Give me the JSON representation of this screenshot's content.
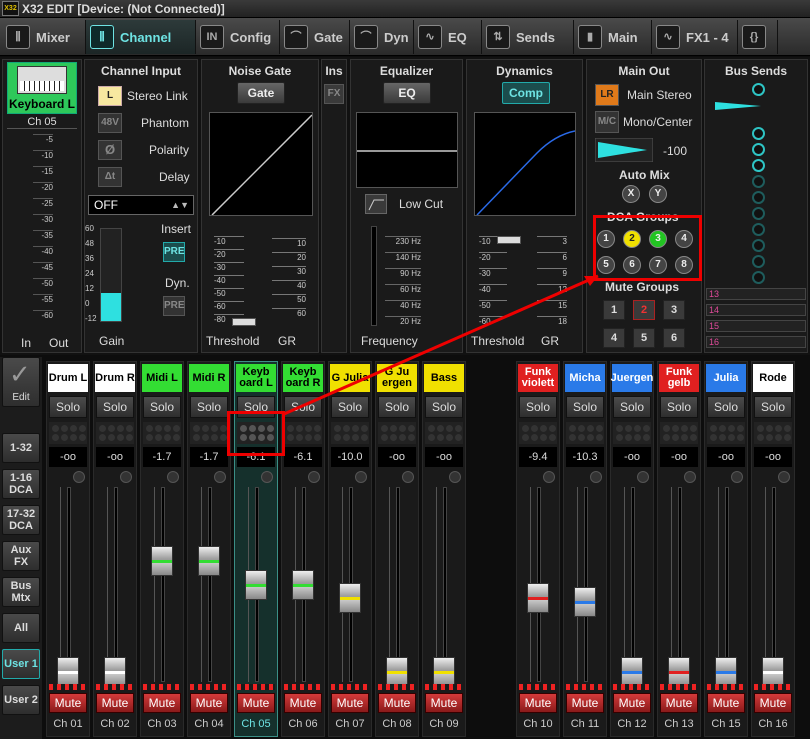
{
  "title": "X32 EDIT [Device: (Not Connected)]",
  "logo": "X32 EDIT",
  "tabs": [
    {
      "label": "Mixer",
      "icon": "faders-icon"
    },
    {
      "label": "Channel",
      "icon": "channel-faders-icon"
    },
    {
      "label": "Config",
      "icon": "input-icon"
    },
    {
      "label": "Gate",
      "icon": "gate-curve-icon"
    },
    {
      "label": "Dyn",
      "icon": "dynamics-curve-icon"
    },
    {
      "label": "EQ",
      "icon": "eq-curve-icon"
    },
    {
      "label": "Sends",
      "icon": "sends-icon"
    },
    {
      "label": "Main",
      "icon": "main-icon"
    },
    {
      "label": "FX1 - 4",
      "icon": "fx-wave-icon"
    },
    {
      "label": "{FX}",
      "icon": "fx-bracket-icon"
    }
  ],
  "channel_badge": {
    "name": "Keyboard L",
    "number": "Ch 05",
    "in_label": "In",
    "out_label": "Out",
    "scale": [
      "-5",
      "-10",
      "-15",
      "-20",
      "-25",
      "-30",
      "-35",
      "-40",
      "-45",
      "-50",
      "-55",
      "-60"
    ]
  },
  "channel_input": {
    "title": "Channel Input",
    "link_btn": "L",
    "stereo_link": "Stereo Link",
    "phantom_btn": "48V",
    "phantom": "Phantom",
    "polarity_btn": "Ø",
    "polarity": "Polarity",
    "delay_btn": "Δt",
    "delay": "Delay",
    "select_value": "OFF",
    "insert": "Insert",
    "dyn": "Dyn.",
    "pre": "PRE",
    "gain_label": "Gain",
    "gain_scale": [
      "60",
      "48",
      "36",
      "24",
      "12",
      "0",
      "-12"
    ],
    "gain_fraction": 0.3
  },
  "noise_gate": {
    "title": "Noise Gate",
    "btn": "Gate",
    "threshold": "Threshold",
    "gr": "GR",
    "scale_left": [
      "-10",
      "-20",
      "-30",
      "-40",
      "-50",
      "-60",
      "-80"
    ],
    "scale_right": [
      "10",
      "20",
      "30",
      "40",
      "50",
      "60"
    ]
  },
  "ins": {
    "title": "Ins",
    "fx": "FX"
  },
  "equalizer": {
    "title": "Equalizer",
    "btn": "EQ",
    "low_cut": "Low Cut",
    "frequency": "Frequency",
    "freq_scale": [
      "230 Hz",
      "140 Hz",
      "90 Hz",
      "60 Hz",
      "40 Hz",
      "20 Hz"
    ]
  },
  "dynamics": {
    "title": "Dynamics",
    "btn": "Comp",
    "threshold": "Threshold",
    "gr": "GR",
    "scale_left": [
      "-10",
      "-20",
      "-30",
      "-40",
      "-50",
      "-60"
    ],
    "scale_right": [
      "3",
      "6",
      "9",
      "12",
      "15",
      "18"
    ]
  },
  "main_out": {
    "title": "Main Out",
    "lr_btn": "LR",
    "main_stereo": "Main Stereo",
    "mc_btn": "M/C",
    "mono_center": "Mono/Center",
    "level": "-100",
    "auto_mix": "Auto Mix",
    "x": "X",
    "y": "Y",
    "dca_title": "DCA Groups",
    "dca": [
      "1",
      "2",
      "3",
      "4",
      "5",
      "6",
      "7",
      "8"
    ],
    "mute_title": "Mute Groups",
    "mute": [
      "1",
      "2",
      "3",
      "4",
      "5",
      "6"
    ]
  },
  "bus_sends": {
    "title": "Bus Sends",
    "bars": [
      "13",
      "14",
      "15",
      "16"
    ]
  },
  "colors": {
    "accent": "#2ec4c4",
    "yellow": "#f0e000",
    "green": "#22c422",
    "red": "#e02020"
  },
  "side_buttons": [
    {
      "label": "Edit"
    },
    {
      "label": "1-32"
    },
    {
      "label": "1-16 DCA"
    },
    {
      "label": "17-32 DCA"
    },
    {
      "label": "Aux FX"
    },
    {
      "label": "Bus Mtx"
    },
    {
      "label": "All"
    },
    {
      "label": "User 1"
    },
    {
      "label": "User 2"
    }
  ],
  "strips": [
    {
      "name": "Drum L",
      "color": "#ffffff",
      "value": "-oo",
      "ch": "Ch 01",
      "fader": 0.05
    },
    {
      "name": "Drum R",
      "color": "#ffffff",
      "value": "-oo",
      "ch": "Ch 02",
      "fader": 0.05
    },
    {
      "name": "Midi L",
      "color": "#33dd33",
      "value": "-1.7",
      "ch": "Ch 03",
      "fader": 0.62
    },
    {
      "name": "Midi R",
      "color": "#33dd33",
      "value": "-1.7",
      "ch": "Ch 04",
      "fader": 0.62
    },
    {
      "name": "Keyb oard L",
      "color": "#33dd33",
      "value": "-6.1",
      "ch": "Ch 05",
      "fader": 0.5
    },
    {
      "name": "Keyb oard R",
      "color": "#33dd33",
      "value": "-6.1",
      "ch": "Ch 06",
      "fader": 0.5
    },
    {
      "name": "G Julia",
      "color": "#f0e000",
      "value": "-10.0",
      "ch": "Ch 07",
      "fader": 0.43
    },
    {
      "name": "G Ju ergen",
      "color": "#f0e000",
      "value": "-oo",
      "ch": "Ch 08",
      "fader": 0.05
    },
    {
      "name": "Bass",
      "color": "#f0e000",
      "value": "-oo",
      "ch": "Ch 09",
      "fader": 0.05
    },
    {
      "name": "Funk violett",
      "color": "#e02020",
      "value": "-9.4",
      "ch": "Ch 10",
      "fader": 0.43
    },
    {
      "name": "Micha",
      "color": "#2a7ae8",
      "value": "-10.3",
      "ch": "Ch 11",
      "fader": 0.41
    },
    {
      "name": "Juergen",
      "color": "#2a7ae8",
      "value": "-oo",
      "ch": "Ch 12",
      "fader": 0.05
    },
    {
      "name": "Funk gelb",
      "color": "#e02020",
      "value": "-oo",
      "ch": "Ch 13",
      "fader": 0.05
    },
    {
      "name": "Julia",
      "color": "#2a7ae8",
      "value": "-oo",
      "ch": "Ch 15",
      "fader": 0.05
    },
    {
      "name": "Rode",
      "color": "#ffffff",
      "value": "-oo",
      "ch": "Ch 16",
      "fader": 0.05
    }
  ],
  "solo_label": "Solo",
  "mute_label": "Mute"
}
